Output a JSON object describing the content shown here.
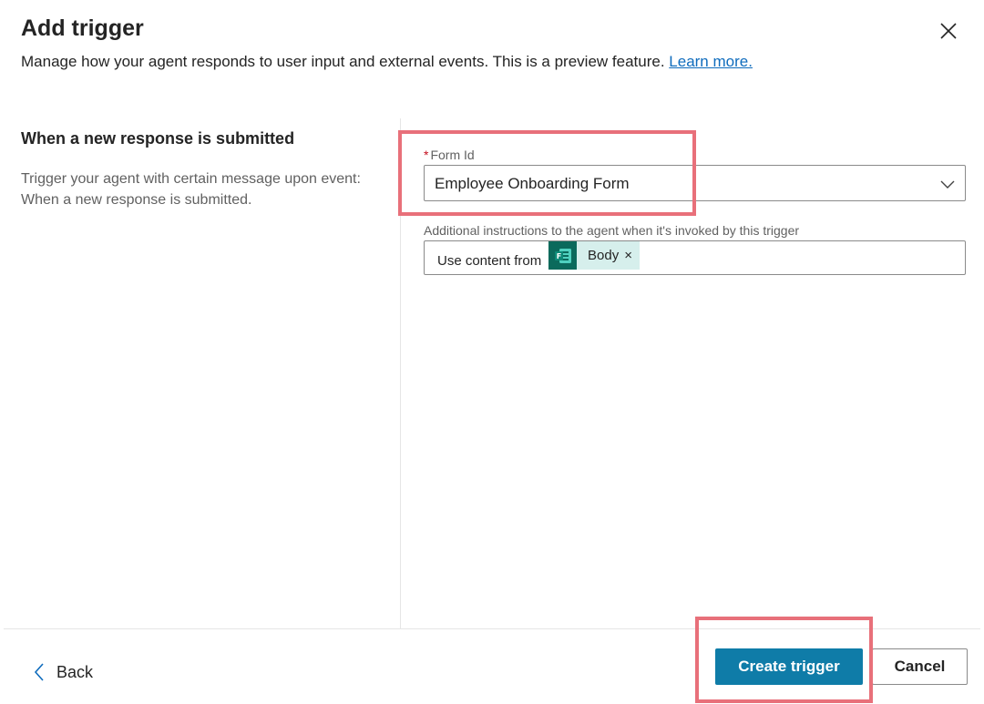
{
  "dialog": {
    "title": "Add trigger",
    "subtitle": "Manage how your agent responds to user input and external events. This is a preview feature.",
    "learn_more": "Learn more."
  },
  "trigger": {
    "heading": "When a new response is submitted",
    "description": "Trigger your agent with certain message upon event: When a new response is submitted."
  },
  "form": {
    "required_marker": "*",
    "form_id_label": "Form Id",
    "form_id_value": "Employee Onboarding Form",
    "instructions_label": "Additional instructions to the agent when it's invoked by this trigger",
    "instructions_prefix": "Use content from",
    "token_label": "Body",
    "token_remove": "×"
  },
  "footer": {
    "back_label": "Back",
    "create_label": "Create trigger",
    "cancel_label": "Cancel"
  },
  "icons": {
    "close": "close-icon",
    "dropdown": "chevron-down-icon",
    "token": "microsoft-forms-icon",
    "back": "chevron-left-icon"
  },
  "colors": {
    "primary_button": "#0f7ca8",
    "link": "#0f6cbd",
    "highlight": "#e8707a",
    "token_background": "#d6efec",
    "token_icon": "#0b6a5c"
  }
}
